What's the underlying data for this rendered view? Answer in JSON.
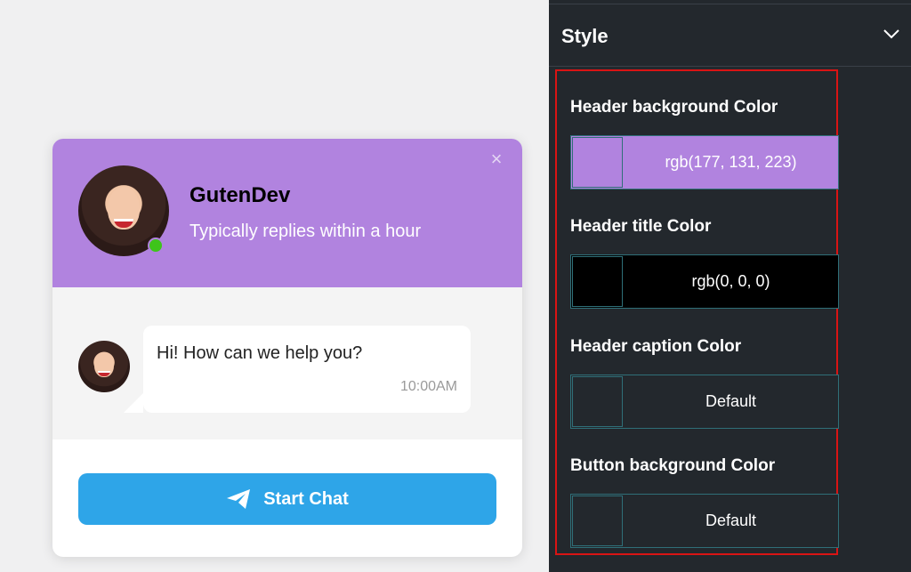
{
  "widget": {
    "close_icon": "close-icon",
    "title": "GutenDev",
    "caption": "Typically replies within a hour",
    "message": "Hi! How can we help you?",
    "time": "10:00AM",
    "button_label": "Start Chat",
    "button_icon": "telegram-send-icon",
    "header_color": "#b183df",
    "button_color": "#2ea5e8",
    "online_color": "#3ec41b"
  },
  "panel": {
    "section_title": "Style",
    "fields": [
      {
        "label": "Header background Color",
        "value": "rgb(177, 131, 223)",
        "color": "#b183df"
      },
      {
        "label": "Header title Color",
        "value": "rgb(0, 0, 0)",
        "color": "#000000"
      },
      {
        "label": "Header caption Color",
        "value": "Default",
        "color": ""
      },
      {
        "label": "Button background Color",
        "value": "Default",
        "color": ""
      }
    ]
  }
}
